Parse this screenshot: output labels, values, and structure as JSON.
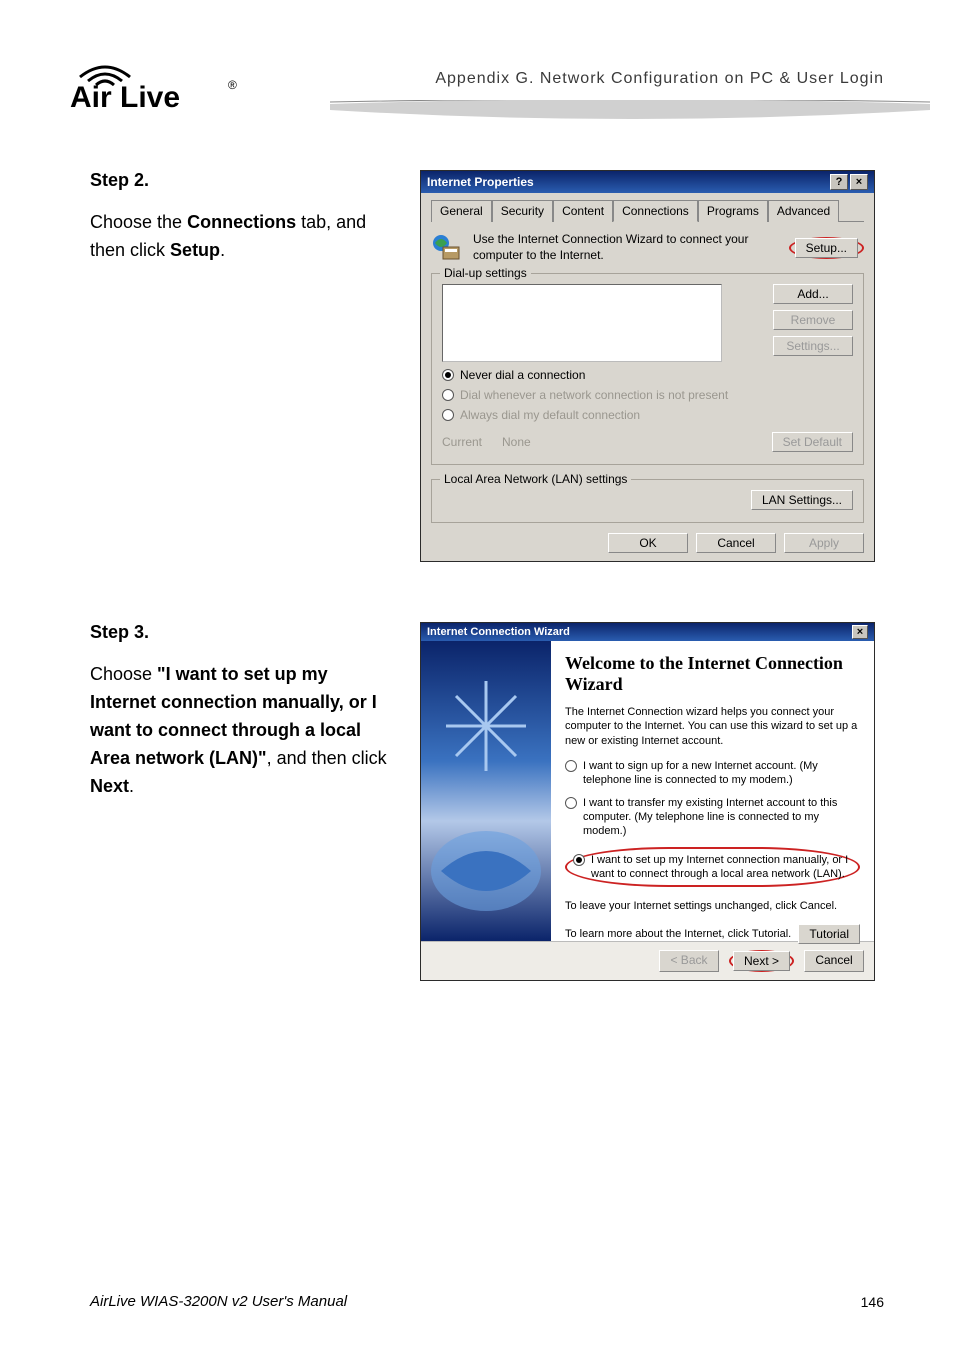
{
  "header": {
    "logo_name": "Air Live",
    "caption": "Appendix G. Network Configuration on PC & User Login"
  },
  "step2": {
    "title": "Step 2.",
    "para": "Choose the {b}Connections{/b} tab, and then click {b}Setup{/b}."
  },
  "step3": {
    "title": "Step 3.",
    "para": "Choose {b}\"I want to set up my Internet connection manually, or I want to connect through a local Area network (LAN)\"{/b}, and then click {b}Next{/b}."
  },
  "ss1": {
    "title": "Internet Properties",
    "help": "?",
    "close": "×",
    "tabs": [
      "General",
      "Security",
      "Content",
      "Connections",
      "Programs",
      "Advanced"
    ],
    "active_tab": "Connections",
    "wizard_text": "Use the Internet Connection Wizard to connect your computer to the Internet.",
    "setup_btn": "Setup...",
    "dialup_label": "Dial-up settings",
    "add_btn": "Add...",
    "remove_btn": "Remove",
    "settings_btn": "Settings...",
    "radio_never": "Never dial a connection",
    "radio_dialwhen": "Dial whenever a network connection is not present",
    "radio_always": "Always dial my default connection",
    "current_label": "Current",
    "current_value": "None",
    "set_default_btn": "Set Default",
    "lan_label": "Local Area Network (LAN) settings",
    "lan_btn": "LAN Settings...",
    "ok_btn": "OK",
    "cancel_btn": "Cancel",
    "apply_btn": "Apply"
  },
  "ss2": {
    "title": "Internet Connection Wizard",
    "close": "×",
    "heading": "Welcome to the Internet Connection Wizard",
    "intro": "The Internet Connection wizard helps you connect your computer to the Internet. You can use this wizard to set up a new or existing Internet account.",
    "opt1": "I want to sign up for a new Internet account. (My telephone line is connected to my modem.)",
    "opt2": "I want to transfer my existing Internet account to this computer. (My telephone line is connected to my modem.)",
    "opt3": "I want to set up my Internet connection manually, or I want to connect through a local area network (LAN).",
    "leave_text": "To leave your Internet settings unchanged, click Cancel.",
    "learn_text": "To learn more about the Internet, click Tutorial.",
    "tutorial_btn": "Tutorial",
    "back_btn": "< Back",
    "next_btn": "Next >",
    "cancel_btn": "Cancel"
  },
  "footer": {
    "left": "AirLive WIAS-3200N v2 User's Manual",
    "page": "146"
  }
}
